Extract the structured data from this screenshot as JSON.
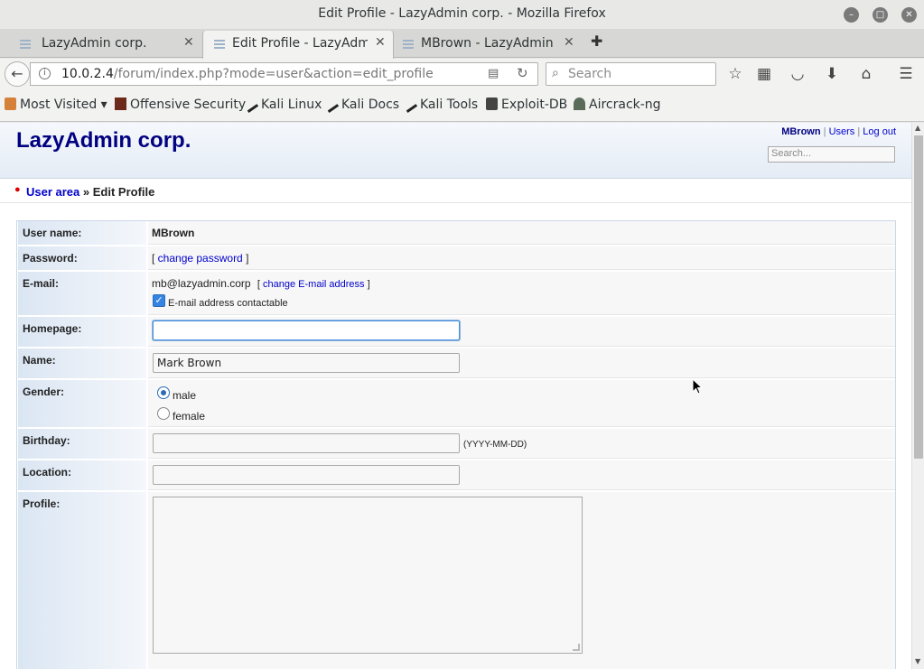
{
  "window": {
    "title": "Edit Profile - LazyAdmin corp. - Mozilla Firefox"
  },
  "tabs": [
    {
      "label": "LazyAdmin corp.",
      "active": false
    },
    {
      "label": "Edit Profile - LazyAdm...",
      "active": true
    },
    {
      "label": "MBrown - LazyAdmin ...",
      "active": false
    }
  ],
  "nav": {
    "url_host": "10.0.2.4",
    "url_path": "/forum/index.php?mode=user&action=edit_profile",
    "search_placeholder": "Search"
  },
  "bookmarks": [
    {
      "label": "Most Visited ▾",
      "icon": "most-visited-icon"
    },
    {
      "label": "Offensive Security",
      "icon": "offsec-icon"
    },
    {
      "label": "Kali Linux",
      "icon": "kali-icon"
    },
    {
      "label": "Kali Docs",
      "icon": "kali-icon"
    },
    {
      "label": "Kali Tools",
      "icon": "kali-icon"
    },
    {
      "label": "Exploit-DB",
      "icon": "exploitdb-icon"
    },
    {
      "label": "Aircrack-ng",
      "icon": "aircrack-icon"
    }
  ],
  "site": {
    "brand": "LazyAdmin corp.",
    "user_link": "MBrown",
    "users_link": "Users",
    "logout_link": "Log out",
    "search_placeholder": "Search...",
    "link_sep": "|"
  },
  "breadcrumb": {
    "parent": "User area",
    "separator": "»",
    "current": "Edit Profile"
  },
  "form": {
    "username_label": "User name:",
    "username_value": "MBrown",
    "password_label": "Password:",
    "password_link": "change password",
    "email_label": "E-mail:",
    "email_value": "mb@lazyadmin.corp",
    "email_link": "change E-mail address",
    "email_contactable_label": "E-mail address contactable",
    "email_contactable_checked": true,
    "homepage_label": "Homepage:",
    "homepage_value": "",
    "name_label": "Name:",
    "name_value": "Mark Brown",
    "gender_label": "Gender:",
    "gender_options": [
      "male",
      "female"
    ],
    "gender_selected": "male",
    "birthday_label": "Birthday:",
    "birthday_value": "",
    "birthday_hint": "(YYYY-MM-DD)",
    "location_label": "Location:",
    "location_value": "",
    "profile_label": "Profile:",
    "profile_value": ""
  },
  "colors": {
    "brand": "#000080",
    "link": "#0000cc",
    "focus": "#4a90d9",
    "accent_dot": "#e00000"
  }
}
